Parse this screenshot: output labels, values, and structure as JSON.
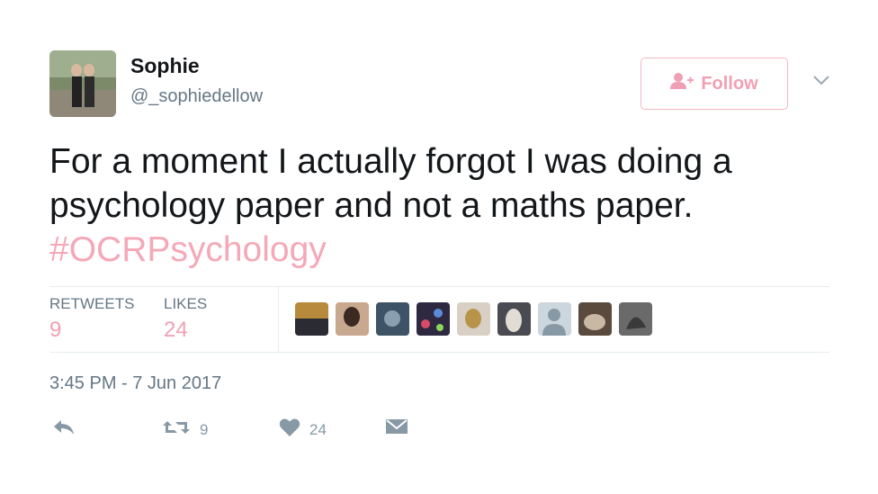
{
  "user": {
    "name": "Sophie",
    "handle": "@_sophiedellow"
  },
  "follow_button": {
    "label": "Follow"
  },
  "tweet": {
    "text_line1": "For a moment I actually forgot I was doing a",
    "text_line2": "psychology paper and not a maths paper.",
    "hashtag": "#OCRPsychology"
  },
  "stats": {
    "retweets_label": "RETWEETS",
    "retweets_value": "9",
    "likes_label": "LIKES",
    "likes_value": "24"
  },
  "timestamp": "3:45 PM - 7 Jun 2017",
  "actions": {
    "reply_icon": "reply-icon",
    "retweet_count": "9",
    "like_count": "24",
    "dm_icon": "message-icon"
  },
  "colors": {
    "accent": "#f0a0b4",
    "hashtag": "#f5a8b8",
    "muted": "#657786"
  }
}
